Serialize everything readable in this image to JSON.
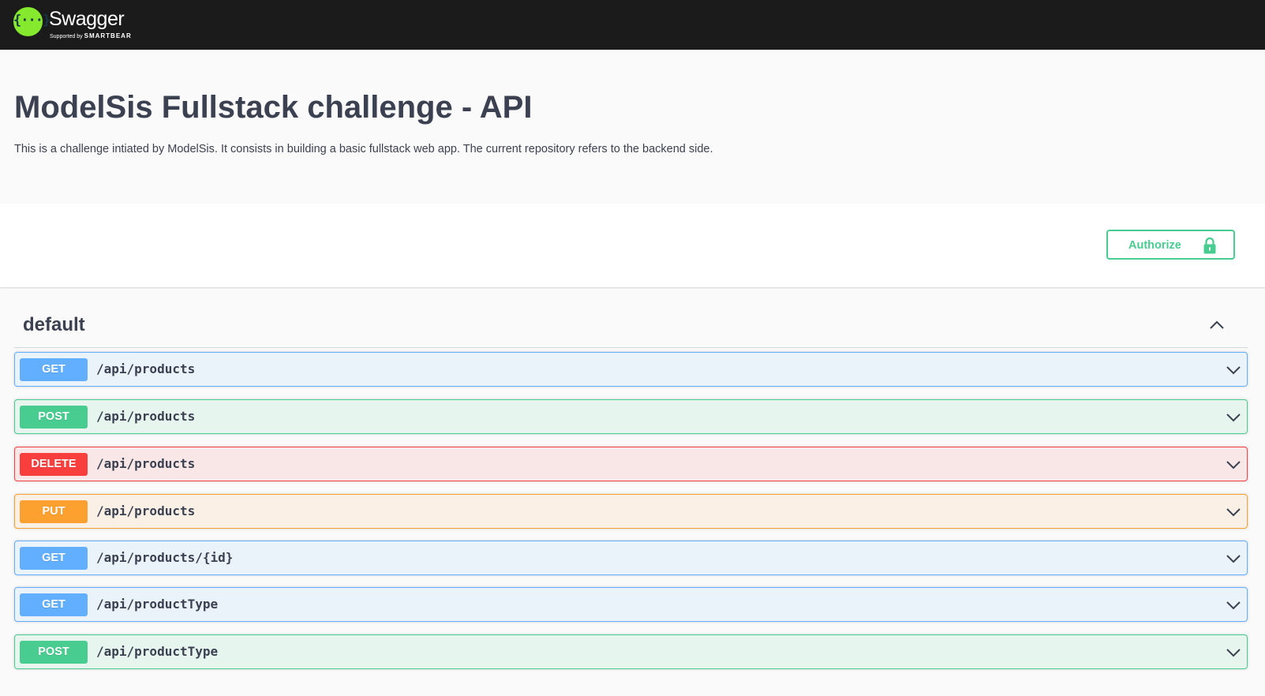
{
  "topbar": {
    "logo_braces": "{···}",
    "logo_name": "Swagger",
    "logo_sub_prefix": "Supported by",
    "logo_sub_brand": "SMARTBEAR"
  },
  "info": {
    "title": "ModelSis Fullstack challenge - API",
    "description": "This is a challenge intiated by ModelSis. It consists in building a basic fullstack web app. The current repository refers to the backend side."
  },
  "scheme": {
    "authorize_label": "Authorize",
    "authorize_icon": "lock-icon"
  },
  "tag": {
    "name": "default",
    "expand_icon": "chevron-up-icon"
  },
  "operations": [
    {
      "method": "GET",
      "path": "/api/products"
    },
    {
      "method": "POST",
      "path": "/api/products"
    },
    {
      "method": "DELETE",
      "path": "/api/products"
    },
    {
      "method": "PUT",
      "path": "/api/products"
    },
    {
      "method": "GET",
      "path": "/api/products/{id}"
    },
    {
      "method": "GET",
      "path": "/api/productType"
    },
    {
      "method": "POST",
      "path": "/api/productType"
    }
  ],
  "colors": {
    "get": "#61affe",
    "post": "#49cc90",
    "delete": "#f93e3e",
    "put": "#fca130",
    "topbar": "#1b1b1b",
    "logo": "#85ea2d"
  }
}
